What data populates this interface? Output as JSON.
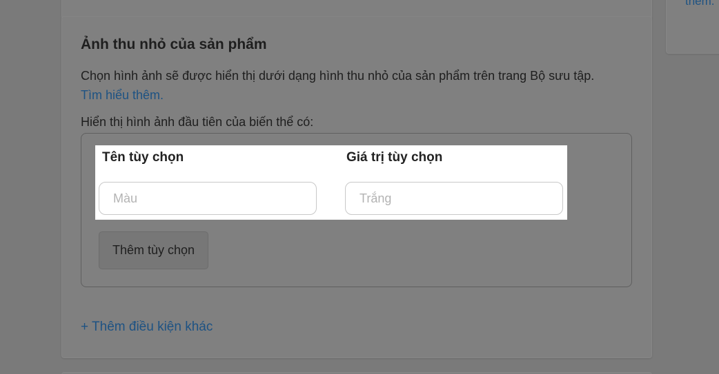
{
  "right_panel": {
    "link_text": "thêm."
  },
  "section": {
    "title": "Ảnh thu nhỏ của sản phẩm",
    "description": "Chọn hình ảnh sẽ được hiển thị dưới dạng hình thu nhỏ của sản phẩm trên trang Bộ sưu tập.",
    "learn_more": "Tìm hiểu thêm.",
    "subheading": "Hiển thị hình ảnh đầu tiên của biến thể có:"
  },
  "options": {
    "name_label": "Tên tùy chọn",
    "value_label": "Giá trị tùy chọn",
    "name_placeholder": "Màu",
    "value_placeholder": "Trắng",
    "add_option_label": "Thêm tùy chọn"
  },
  "add_condition_label": "+ Thêm điều kiện khác",
  "colors": {
    "link": "#1d5283",
    "overlay_background": "#7a7a7a",
    "highlight": "#ffffff"
  }
}
